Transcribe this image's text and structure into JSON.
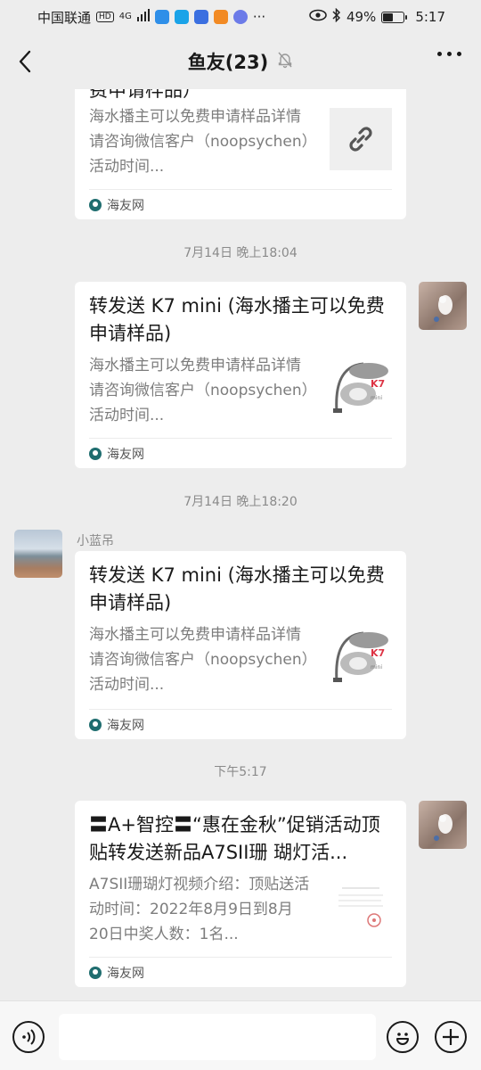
{
  "status_bar": {
    "carrier": "中国联通",
    "hd": "HD",
    "network": "4G",
    "battery": "49%",
    "time": "5:17",
    "more_dots": "···"
  },
  "header": {
    "title": "鱼友(23)"
  },
  "messages": [
    {
      "title_partial": "费申请样品）",
      "desc": "海水播主可以免费申请样品详情请咨询微信客户（noopsychen）活动时间...",
      "source": "海友网"
    },
    {
      "timestamp": "7月14日 晚上18:04",
      "title": "转发送 K7 mini (海水播主可以免费申请样品)",
      "desc": "海水播主可以免费申请样品详情请咨询微信客户（noopsychen）活动时间...",
      "source": "海友网"
    },
    {
      "timestamp": "7月14日 晚上18:20",
      "sender": "小蓝吊",
      "title": "转发送 K7 mini (海水播主可以免费申请样品)",
      "desc": "海水播主可以免费申请样品详情请咨询微信客户（noopsychen）活动时间...",
      "source": "海友网"
    },
    {
      "timestamp": "下午5:17",
      "title": "〓A+智控〓“惠在金秋”促销活动顶贴转发送新品A7SII珊 瑚灯活...",
      "desc": "A7SII珊瑚灯视频介绍：顶贴送活动时间：2022年8月9日到8月20日中奖人数：1名...",
      "source": "海友网"
    }
  ],
  "colors": {
    "background": "#ededed",
    "card": "#ffffff",
    "text": "#191919",
    "muted": "#7d7d7d"
  },
  "icons": [
    "back-icon",
    "mute-bell-icon",
    "more-icon",
    "link-icon",
    "voice-icon",
    "emoji-icon",
    "plus-icon"
  ]
}
